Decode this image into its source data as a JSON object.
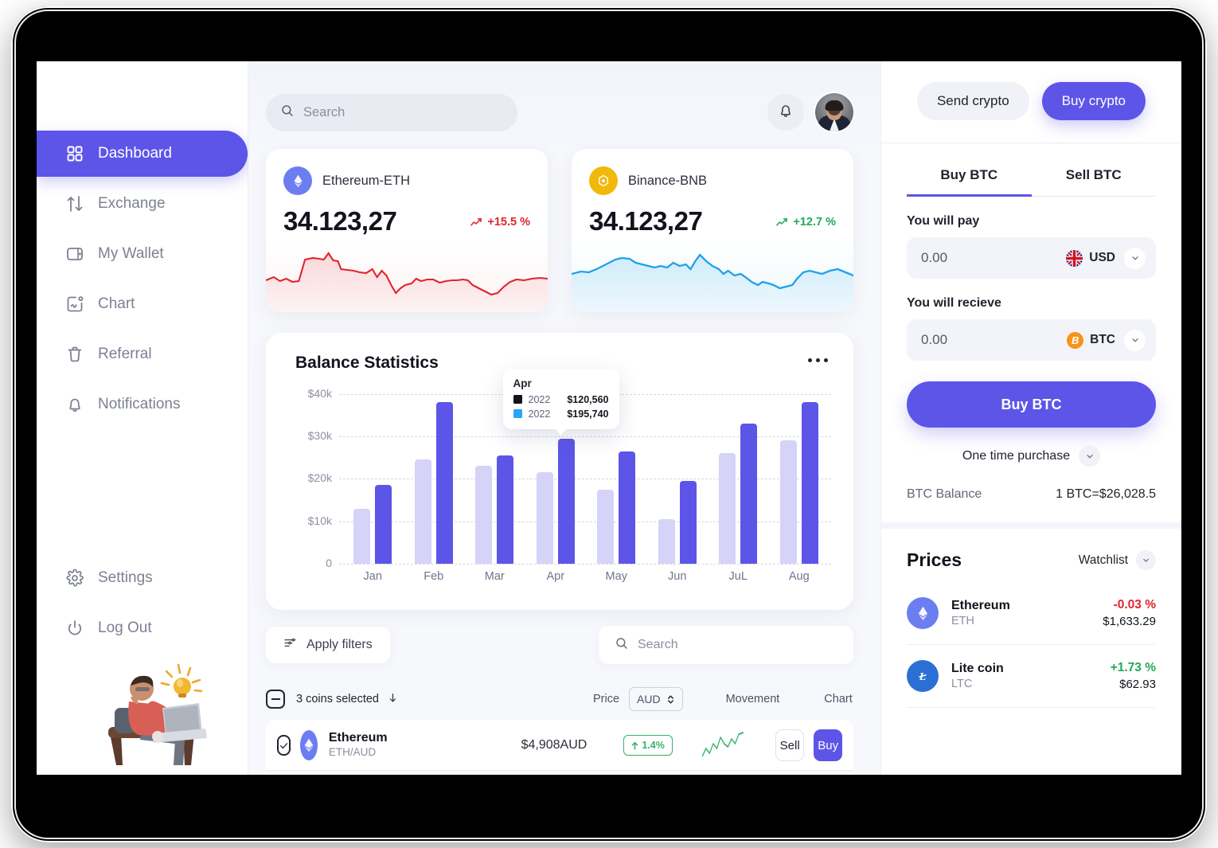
{
  "sidebar": {
    "items": [
      {
        "label": "Dashboard",
        "icon": "grid-icon",
        "active": true
      },
      {
        "label": "Exchange",
        "icon": "exchange-arrows-icon",
        "active": false
      },
      {
        "label": "My Wallet",
        "icon": "wallet-icon",
        "active": false
      },
      {
        "label": "Chart",
        "icon": "chart-icon",
        "active": false
      },
      {
        "label": "Referral",
        "icon": "referral-icon",
        "active": false
      },
      {
        "label": "Notifications",
        "icon": "bell-icon",
        "active": false
      }
    ],
    "bottom_items": [
      {
        "label": "Settings",
        "icon": "gear-icon"
      },
      {
        "label": "Log Out",
        "icon": "power-icon"
      }
    ]
  },
  "topbar": {
    "search_placeholder": "Search",
    "bell_icon": "bell-icon",
    "avatar_name": "user-avatar"
  },
  "coin_cards": [
    {
      "name": "Ethereum-ETH",
      "price": "34.123,27",
      "change": "+15.5 %",
      "change_color": "#e0242e",
      "logo_bg": "#6c7df0",
      "symbol": "ETH"
    },
    {
      "name": "Binance-BNB",
      "price": "34.123,27",
      "change": "+12.7 %",
      "change_color": "#22a85a",
      "logo_bg": "#f0b90b",
      "symbol": "BNB"
    }
  ],
  "balance": {
    "title": "Balance Statistics",
    "menu_icon": "more-horizontal-icon"
  },
  "chart_data": {
    "type": "bar",
    "title": "Balance Statistics",
    "xlabel": "",
    "ylabel": "",
    "categories": [
      "Jan",
      "Feb",
      "Mar",
      "Apr",
      "May",
      "Jun",
      "JuL",
      "Aug"
    ],
    "ytick_labels": [
      "0",
      "$10k",
      "$20k",
      "$30k",
      "$40k"
    ],
    "ytick_values": [
      0,
      10000,
      20000,
      30000,
      40000
    ],
    "ylim": [
      0,
      42000
    ],
    "grid": true,
    "legend_position": "tooltip",
    "series": [
      {
        "name": "2022",
        "color": "#d5d3f8",
        "values": [
          13000,
          24500,
          23000,
          21500,
          17500,
          10500,
          26000,
          29000
        ]
      },
      {
        "name": "2022",
        "color": "#5d55e8",
        "values": [
          18500,
          38000,
          25500,
          29500,
          26500,
          19500,
          33000,
          38000
        ]
      }
    ],
    "tooltip": {
      "label": "Apr",
      "rows": [
        {
          "swatch": "#12141c",
          "year": "2022",
          "value": "$120,560"
        },
        {
          "swatch": "#27a6f5",
          "year": "2022",
          "value": "$195,740"
        }
      ]
    }
  },
  "filters": {
    "apply_label": "Apply filters",
    "filter_icon": "filter-icon",
    "search_placeholder": "Search",
    "search_icon": "search-icon"
  },
  "table": {
    "selected_label": "3 coins selected",
    "sort_icon": "arrow-down-icon",
    "columns": [
      "Price",
      "Movement",
      "Chart"
    ],
    "currency_selector": "AUD",
    "rows": [
      {
        "name": "Ethereum",
        "pair": "ETH/AUD",
        "price": "$4,908AUD",
        "movement": "1.4%",
        "movement_dir": "up",
        "sell_label": "Sell",
        "buy_label": "Buy",
        "logo_bg": "#6c7df0"
      }
    ]
  },
  "right_panel": {
    "send_label": "Send crypto",
    "buy_label": "Buy crypto",
    "tabs": [
      {
        "label": "Buy BTC",
        "active": true
      },
      {
        "label": "Sell BTC",
        "active": false
      }
    ],
    "pay_label": "You will pay",
    "pay_value": "0.00",
    "pay_currency": "USD",
    "pay_currency_icon": "uk-flag-icon",
    "receive_label": "You will recieve",
    "receive_value": "0.00",
    "receive_currency": "BTC",
    "receive_currency_icon": "bitcoin-icon",
    "action_label": "Buy BTC",
    "purchase_type": "One time purchase",
    "balance_label": "BTC Balance",
    "balance_value": "1 BTC=$26,028.5",
    "prices_title": "Prices",
    "watchlist_label": "Watchlist",
    "prices": [
      {
        "name": "Ethereum",
        "symbol": "ETH",
        "change": "-0.03 %",
        "price": "$1,633.29",
        "change_color": "#e0242e",
        "logo_bg": "#6c7df0"
      },
      {
        "name": "Lite coin",
        "symbol": "LTC",
        "change": "+1.73 %",
        "price": "$62.93",
        "change_color": "#22a85a",
        "logo_bg": "#2b6fd4"
      }
    ]
  },
  "theme": {
    "accent": "#5d55e8",
    "bar_light": "#d5d3f8",
    "up_green": "#22a85a",
    "down_red": "#e0242e",
    "bg": "#f7f8fc"
  }
}
